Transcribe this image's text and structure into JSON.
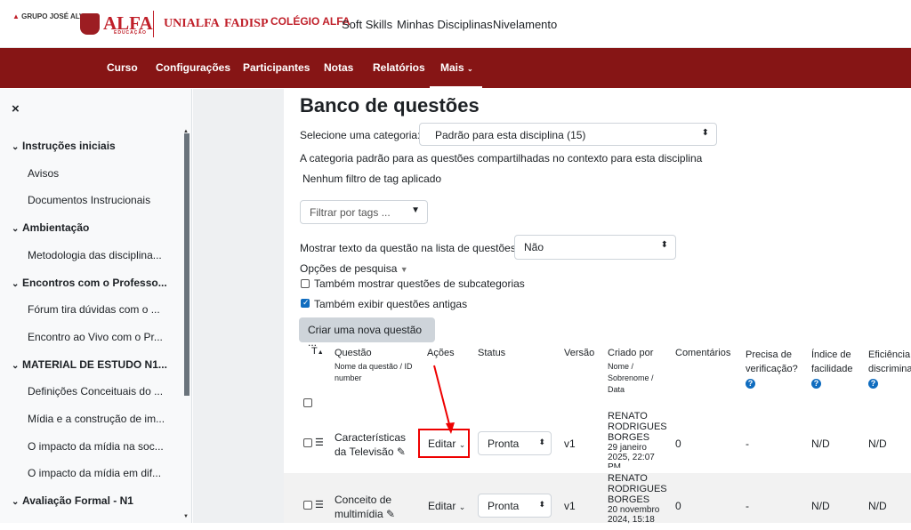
{
  "header": {
    "logos": [
      "GRUPO JOSÉ ALVES",
      "ALFA",
      "EDUCAÇÃO",
      "UNIALFA",
      "FADISP",
      "COLÉGIO ALFA"
    ],
    "links": [
      "Soft Skills",
      "Minhas Disciplinas",
      "Nivelamento"
    ]
  },
  "navbar": {
    "items": [
      "Curso",
      "Configurações",
      "Participantes",
      "Notas",
      "Relatórios",
      "Mais"
    ]
  },
  "drawer": {
    "close": "×",
    "entries": [
      {
        "type": "section",
        "label": "Instruções iniciais"
      },
      {
        "type": "item",
        "label": "Avisos"
      },
      {
        "type": "item",
        "label": "Documentos Instrucionais"
      },
      {
        "type": "section",
        "label": "Ambientação"
      },
      {
        "type": "item",
        "label": "Metodologia das disciplina..."
      },
      {
        "type": "section",
        "label": "Encontros com o Professo..."
      },
      {
        "type": "item",
        "label": "Fórum tira dúvidas com o ..."
      },
      {
        "type": "item",
        "label": "Encontro ao Vivo com o Pr..."
      },
      {
        "type": "section",
        "label": "MATERIAL DE ESTUDO N1..."
      },
      {
        "type": "item",
        "label": "Definições Conceituais do ..."
      },
      {
        "type": "item",
        "label": "Mídia e a construção de im..."
      },
      {
        "type": "item",
        "label": "O impacto da mídia na soc..."
      },
      {
        "type": "item",
        "label": "O impacto da mídia em dif..."
      },
      {
        "type": "section",
        "label": "Avaliação Formal - N1"
      }
    ]
  },
  "main": {
    "title": "Banco de questões",
    "category_label": "Selecione uma categoria:",
    "category_value": "Padrão para esta disciplina (15)",
    "category_desc": "A categoria padrão para as questões compartilhadas no contexto para esta disciplina",
    "tag_status": "Nenhum filtro de tag aplicado",
    "tag_placeholder": "Filtrar por tags ...",
    "show_text_label": "Mostrar texto da questão na lista de questões?",
    "show_text_value": "Não",
    "search_options": "Opções de pesquisa",
    "opt_subcats": "Também mostrar questões de subcategorias",
    "opt_old": "Também exibir questões antigas",
    "new_question": "Criar uma nova questão ..."
  },
  "table": {
    "headers": {
      "t": "T",
      "question": "Questão",
      "question_sub": "Nome da questão / ID number",
      "actions": "Ações",
      "status": "Status",
      "version": "Versão",
      "created": "Criado por",
      "created_sub": "Nome / Sobrenome / Data",
      "comments": "Comentários",
      "needs_check": "Precisa de verificação?",
      "facility": "Índice de facilidade",
      "efficiency": "Eficiência discrimina"
    },
    "rows": [
      {
        "name": "Características da Televisão",
        "action": "Editar",
        "status": "Pronta",
        "version": "v1",
        "author": "RENATO RODRIGUES BORGES",
        "date": "29 janeiro 2025, 22:07 PM",
        "comments": "0",
        "needs_check": "-",
        "facility": "N/D",
        "efficiency": "N/D"
      },
      {
        "name": "Conceito de multimídia",
        "action": "Editar",
        "status": "Pronta",
        "version": "v1",
        "author": "RENATO RODRIGUES BORGES",
        "date": "20 novembro 2024, 15:18",
        "comments": "0",
        "needs_check": "-",
        "facility": "N/D",
        "efficiency": "N/D"
      }
    ]
  },
  "colors": {
    "brand": "#861515",
    "logo_red": "#c0202a",
    "highlight": "#e00000"
  }
}
